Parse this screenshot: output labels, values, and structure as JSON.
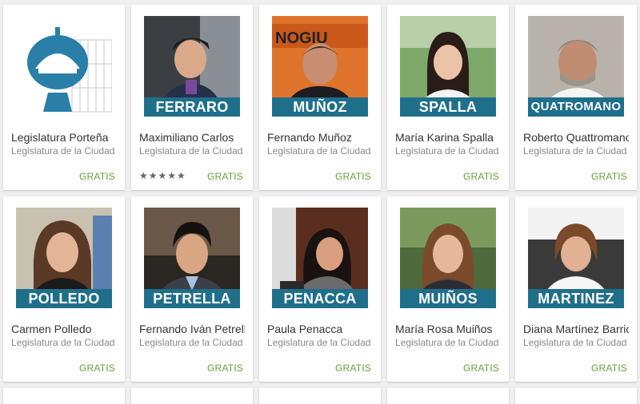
{
  "apps": [
    {
      "title": "Legislatura Porteña",
      "developer": "Legislatura de la Ciudad",
      "price": "GRATIS",
      "banner": "",
      "icon": "legislature-dome-logo",
      "accent": "#2a7fa8"
    },
    {
      "title": "Maximiliano Carlos",
      "developer": "Legislatura de la Ciudad",
      "price": "GRATIS",
      "banner": "FERRARO",
      "stars": "★★★★★"
    },
    {
      "title": "Fernando Muñoz",
      "developer": "Legislatura de la Ciudad",
      "price": "GRATIS",
      "banner": "MUÑOZ"
    },
    {
      "title": "María Karina Spalla",
      "developer": "Legislatura de la Ciudad",
      "price": "GRATIS",
      "banner": "SPALLA"
    },
    {
      "title": "Roberto Quattromano",
      "developer": "Legislatura de la Ciudad",
      "price": "GRATIS",
      "banner": "QUATROMANO"
    },
    {
      "title": "Carmen Polledo",
      "developer": "Legislatura de la Ciudad",
      "price": "GRATIS",
      "banner": "POLLEDO"
    },
    {
      "title": "Fernando Iván Petrella",
      "developer": "Legislatura de la Ciudad",
      "price": "GRATIS",
      "banner": "PETRELLA"
    },
    {
      "title": "Paula Penacca",
      "developer": "Legislatura de la Ciudad",
      "price": "GRATIS",
      "banner": "PENACCA"
    },
    {
      "title": "María Rosa Muiños",
      "developer": "Legislatura de la Ciudad",
      "price": "GRATIS",
      "banner": "MUIÑOS"
    },
    {
      "title": "Diana Martínez Barrios",
      "developer": "Legislatura de la Ciudad",
      "price": "GRATIS",
      "banner": "MARTINEZ"
    }
  ],
  "colors": {
    "banner": "#1f6f8b",
    "price": "#689f38",
    "background": "#efefef"
  }
}
